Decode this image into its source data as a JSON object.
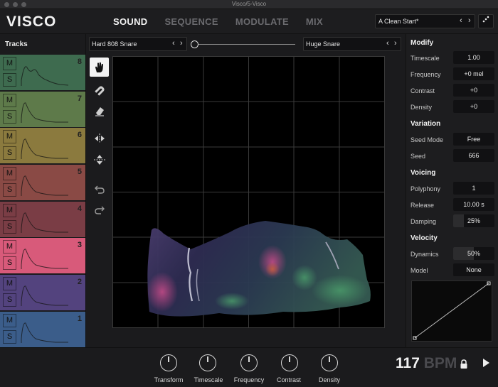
{
  "window": {
    "title": "Visco/5-Visco"
  },
  "header": {
    "logo": "VISCO",
    "tabs": [
      {
        "label": "SOUND",
        "active": true
      },
      {
        "label": "SEQUENCE",
        "active": false
      },
      {
        "label": "MODULATE",
        "active": false
      },
      {
        "label": "MIX",
        "active": false
      }
    ],
    "preset": {
      "name": "A Clean Start*",
      "prev": "‹",
      "next": "›"
    },
    "menu_icon": "dots-icon"
  },
  "tracks": {
    "title": "Tracks",
    "mute_label": "M",
    "solo_label": "S",
    "items": [
      {
        "number": "8",
        "color": "#3e6b4f",
        "wave": "multi-peak"
      },
      {
        "number": "7",
        "color": "#5e7a4a",
        "wave": "decay"
      },
      {
        "number": "6",
        "color": "#8b7a3e",
        "wave": "decay"
      },
      {
        "number": "5",
        "color": "#8a4a45",
        "wave": "decay"
      },
      {
        "number": "4",
        "color": "#7a3d45",
        "wave": "decay"
      },
      {
        "number": "3",
        "color": "#d85a7a",
        "wave": "decay"
      },
      {
        "number": "2",
        "color": "#53437e",
        "wave": "decay"
      },
      {
        "number": "1",
        "color": "#3b5d8a",
        "wave": "decay"
      }
    ]
  },
  "samples": {
    "left": "Hard 808 Snare",
    "right": "Huge Snare",
    "blend": 0
  },
  "tools": [
    "hand-icon",
    "magnet-icon",
    "eraser-icon",
    "flip-horizontal-icon",
    "flip-vertical-icon",
    "undo-icon",
    "redo-icon"
  ],
  "panel": {
    "modify": {
      "title": "Modify",
      "params": [
        {
          "label": "Timescale",
          "value": "1.00"
        },
        {
          "label": "Frequency",
          "value": "+0 mel"
        },
        {
          "label": "Contrast",
          "value": "+0"
        },
        {
          "label": "Density",
          "value": "+0"
        }
      ]
    },
    "variation": {
      "title": "Variation",
      "params": [
        {
          "label": "Seed Mode",
          "value": "Free"
        },
        {
          "label": "Seed",
          "value": "666"
        }
      ]
    },
    "voicing": {
      "title": "Voicing",
      "params": [
        {
          "label": "Polyphony",
          "value": "1"
        },
        {
          "label": "Release",
          "value": "10.00 s"
        },
        {
          "label": "Damping",
          "value": "25%"
        }
      ]
    },
    "velocity": {
      "title": "Velocity",
      "params": [
        {
          "label": "Dynamics",
          "value": "50%"
        },
        {
          "label": "Model",
          "value": "None"
        }
      ]
    }
  },
  "bottom": {
    "knobs": [
      "Transform",
      "Timescale",
      "Frequency",
      "Contrast",
      "Density"
    ],
    "bpm_value": "117",
    "bpm_unit": "BPM"
  }
}
